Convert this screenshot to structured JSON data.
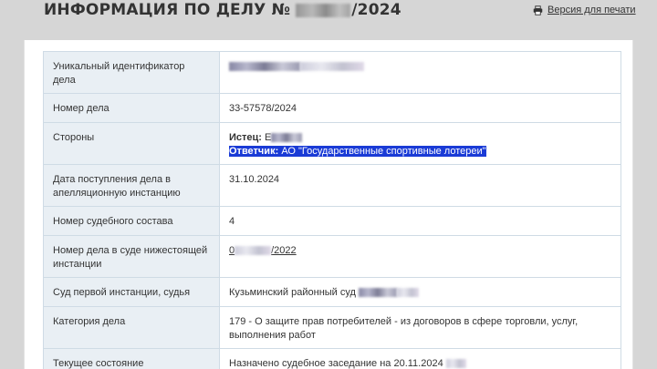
{
  "header": {
    "title_prefix": "ИНФОРМАЦИЯ ПО ДЕЛУ №",
    "title_suffix": "/2024",
    "print_label": "Версия для печати",
    "print_icon": "printer-icon"
  },
  "case_info": {
    "rows": [
      {
        "label": "Уникальный идентификатор дела"
      },
      {
        "label": "Номер дела",
        "value": "33-57578/2024"
      },
      {
        "label": "Стороны",
        "plaintiff_label": "Истец:",
        "plaintiff_initial": "Е",
        "defendant_label": "Ответчик:",
        "defendant_value": "АО \"Государственные спортивные лотереи\""
      },
      {
        "label": "Дата поступления дела в апелляционную инстанцию",
        "value": "31.10.2024"
      },
      {
        "label": "Номер судебного состава",
        "value": "4"
      },
      {
        "label": "Номер дела в суде нижестоящей инстанции",
        "value_prefix": "0",
        "value_suffix": "/2022"
      },
      {
        "label": "Суд первой инстанции, судья",
        "value": "Кузьминский районный суд"
      },
      {
        "label": "Категория дела",
        "value": "179 - О защите прав потребителей - из договоров в сфере торговли, услуг, выполнения работ"
      },
      {
        "label": "Текущее состояние",
        "value": "Назначено судебное заседание на 20.11.2024"
      }
    ]
  },
  "colors": {
    "page_bg": "#d6d6d6",
    "label_bg": "#e9eff4",
    "border": "#cfdbe5",
    "highlight": "#1a3bd6"
  }
}
